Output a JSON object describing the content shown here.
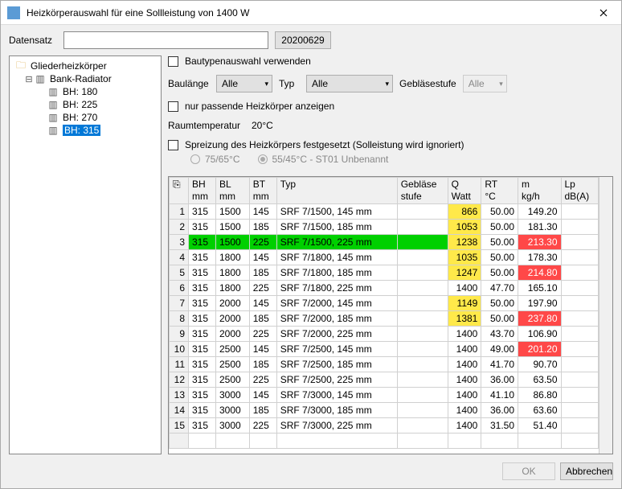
{
  "window": {
    "title": "Heizkörperauswahl für eine Sollleistung von 1400 W"
  },
  "form": {
    "dataset_label": "Datensatz",
    "dataset_value": "",
    "date_button": "20200629",
    "use_types_label": "Bautypenauswahl verwenden",
    "length_label": "Baulänge",
    "length_value": "Alle",
    "type_label": "Typ",
    "type_value": "Alle",
    "fan_label": "Gebläsestufe",
    "fan_value": "Alle",
    "fitting_only_label": "nur passende Heizkörper anzeigen",
    "room_temp_label": "Raumtemperatur",
    "room_temp_value": "20°C",
    "spread_label": "Spreizung des Heizkörpers festgesetzt (Solleistung wird ignoriert)",
    "radio1": "75/65°C",
    "radio2": "55/45°C - ST01 Unbenannt"
  },
  "tree": {
    "root": "Gliederheizkörper",
    "group": "Bank-Radiator",
    "leaves": [
      "BH:   180",
      "BH:   225",
      "BH:   270",
      "BH:   315"
    ]
  },
  "table": {
    "headers": [
      {
        "l1": "BH",
        "l2": "mm"
      },
      {
        "l1": "BL",
        "l2": "mm"
      },
      {
        "l1": "BT",
        "l2": "mm"
      },
      {
        "l1": "Typ",
        "l2": ""
      },
      {
        "l1": "Gebläse",
        "l2": "stufe"
      },
      {
        "l1": "Q",
        "l2": "Watt"
      },
      {
        "l1": "RT",
        "l2": "°C"
      },
      {
        "l1": "m",
        "l2": "kg/h"
      },
      {
        "l1": "Lp",
        "l2": "dB(A)"
      }
    ],
    "rows": [
      {
        "n": 1,
        "bh": "315",
        "bl": "1500",
        "bt": "145",
        "typ": "SRF 7/1500, 145 mm",
        "q": "866",
        "q_hl": "yellow",
        "rt": "50.00",
        "m": "149.20"
      },
      {
        "n": 2,
        "bh": "315",
        "bl": "1500",
        "bt": "185",
        "typ": "SRF 7/1500, 185 mm",
        "q": "1053",
        "q_hl": "yellow",
        "rt": "50.00",
        "m": "181.30"
      },
      {
        "n": 3,
        "bh": "315",
        "bl": "1500",
        "bt": "225",
        "typ": "SRF 7/1500, 225 mm",
        "q": "1238",
        "q_hl": "yellow",
        "rt": "50.00",
        "m": "213.30",
        "m_hl": "red",
        "row_hl": "green"
      },
      {
        "n": 4,
        "bh": "315",
        "bl": "1800",
        "bt": "145",
        "typ": "SRF 7/1800, 145 mm",
        "q": "1035",
        "q_hl": "yellow",
        "rt": "50.00",
        "m": "178.30"
      },
      {
        "n": 5,
        "bh": "315",
        "bl": "1800",
        "bt": "185",
        "typ": "SRF 7/1800, 185 mm",
        "q": "1247",
        "q_hl": "yellow",
        "rt": "50.00",
        "m": "214.80",
        "m_hl": "red"
      },
      {
        "n": 6,
        "bh": "315",
        "bl": "1800",
        "bt": "225",
        "typ": "SRF 7/1800, 225 mm",
        "q": "1400",
        "rt": "47.70",
        "m": "165.10"
      },
      {
        "n": 7,
        "bh": "315",
        "bl": "2000",
        "bt": "145",
        "typ": "SRF 7/2000, 145 mm",
        "q": "1149",
        "q_hl": "yellow",
        "rt": "50.00",
        "m": "197.90"
      },
      {
        "n": 8,
        "bh": "315",
        "bl": "2000",
        "bt": "185",
        "typ": "SRF 7/2000, 185 mm",
        "q": "1381",
        "q_hl": "yellow",
        "rt": "50.00",
        "m": "237.80",
        "m_hl": "red"
      },
      {
        "n": 9,
        "bh": "315",
        "bl": "2000",
        "bt": "225",
        "typ": "SRF 7/2000, 225 mm",
        "q": "1400",
        "rt": "43.70",
        "m": "106.90"
      },
      {
        "n": 10,
        "bh": "315",
        "bl": "2500",
        "bt": "145",
        "typ": "SRF 7/2500, 145 mm",
        "q": "1400",
        "rt": "49.00",
        "m": "201.20",
        "m_hl": "red"
      },
      {
        "n": 11,
        "bh": "315",
        "bl": "2500",
        "bt": "185",
        "typ": "SRF 7/2500, 185 mm",
        "q": "1400",
        "rt": "41.70",
        "m": "90.70"
      },
      {
        "n": 12,
        "bh": "315",
        "bl": "2500",
        "bt": "225",
        "typ": "SRF 7/2500, 225 mm",
        "q": "1400",
        "rt": "36.00",
        "m": "63.50"
      },
      {
        "n": 13,
        "bh": "315",
        "bl": "3000",
        "bt": "145",
        "typ": "SRF 7/3000, 145 mm",
        "q": "1400",
        "rt": "41.10",
        "m": "86.80"
      },
      {
        "n": 14,
        "bh": "315",
        "bl": "3000",
        "bt": "185",
        "typ": "SRF 7/3000, 185 mm",
        "q": "1400",
        "rt": "36.00",
        "m": "63.60"
      },
      {
        "n": 15,
        "bh": "315",
        "bl": "3000",
        "bt": "225",
        "typ": "SRF 7/3000, 225 mm",
        "q": "1400",
        "rt": "31.50",
        "m": "51.40"
      }
    ]
  },
  "footer": {
    "ok": "OK",
    "cancel": "Abbrechen"
  }
}
